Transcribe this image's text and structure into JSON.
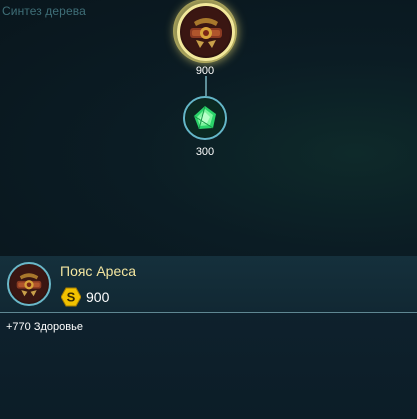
{
  "tree": {
    "title": "Синтез дерева",
    "root_node": {
      "icon": "ares-belt-icon",
      "price": "900",
      "selected": true
    },
    "child_node": {
      "icon": "green-gem-icon",
      "price": "300"
    }
  },
  "details": {
    "icon": "ares-belt-icon",
    "name": "Пояс Ареса",
    "currency_icon": "gold-coin-icon",
    "cost": "900",
    "stats": [
      "+770 Здоровье"
    ]
  },
  "colors": {
    "background": "#0b1a22",
    "title_text": "#3f6f78",
    "selected_glow": "#f2e89a",
    "node_border": "#64b6c8",
    "item_name": "#f3e6a0",
    "coin": "#f2c200"
  }
}
